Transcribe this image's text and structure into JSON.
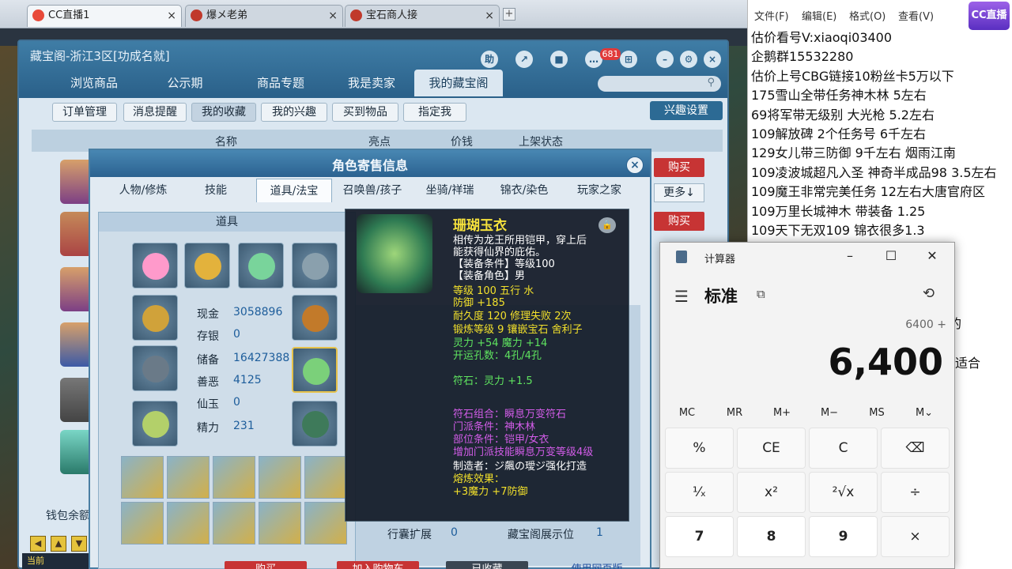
{
  "browser": {
    "tabs": [
      {
        "label": "CC直播1",
        "close": "×"
      },
      {
        "label": "爆メ老弟",
        "close": "×"
      },
      {
        "label": "宝石商人接",
        "close": "×"
      }
    ],
    "new_tab": "+"
  },
  "game_overlay": {
    "label": "当前"
  },
  "cbg": {
    "title": "藏宝阁-浙江3区[功成名就]",
    "help": "助",
    "message_count": "681",
    "nav_tabs": [
      "浏览商品",
      "公示期",
      "商品专题",
      "我是卖家",
      "我的藏宝阁"
    ],
    "sub_buttons": [
      "订单管理",
      "消息提醒",
      "我的收藏",
      "我的兴趣",
      "买到物品",
      "指定我"
    ],
    "interest_settings": "兴趣设置",
    "table_headers": [
      "名称",
      "亮点",
      "价钱",
      "上架状态"
    ],
    "buy": "购买",
    "more": "更多↓",
    "wallet": "钱包余额"
  },
  "dialog": {
    "title": "角色寄售信息",
    "close": "×",
    "tabs": [
      "人物/修炼",
      "技能",
      "道具/法宝",
      "召唤兽/孩子",
      "坐骑/祥瑞",
      "锦衣/染色",
      "玩家之家"
    ],
    "inventory_header": "道具",
    "stats": [
      {
        "label": "现金",
        "value": "3058896"
      },
      {
        "label": "存银",
        "value": "0"
      },
      {
        "label": "储备",
        "value": "16427388"
      },
      {
        "label": "善恶",
        "value": "4125"
      },
      {
        "label": "仙玉",
        "value": "0"
      },
      {
        "label": "精力",
        "value": "231"
      }
    ],
    "expand_label": "行囊扩展",
    "expand_value": "0",
    "showpos_label": "藏宝阁展示位",
    "showpos_value": "1",
    "bottom_buttons": [
      "购买",
      "加入购物车",
      "已收藏",
      "使用网页版"
    ]
  },
  "tooltip": {
    "name": "珊瑚玉衣",
    "lock": "🔒",
    "lines": [
      {
        "text": "相传为龙王所用铠甲，穿上后",
        "color": "w"
      },
      {
        "text": "能获得仙界的庇佑。",
        "color": "w"
      },
      {
        "text": "【装备条件】等级100",
        "color": "w"
      },
      {
        "text": "【装备角色】男",
        "color": "w"
      },
      {
        "text": "等级 100   五行 水",
        "color": "y"
      },
      {
        "text": "防御 +185",
        "color": "y"
      },
      {
        "text": "耐久度 120   修理失败 2次",
        "color": "y"
      },
      {
        "text": "锻炼等级 9   镶嵌宝石 舍利子",
        "color": "y"
      },
      {
        "text": "灵力 +54 魔力 +14",
        "color": "g"
      },
      {
        "text": "开运孔数：4孔/4孔",
        "color": "g"
      },
      {
        "text": "符石：灵力 +1.5",
        "color": "g"
      },
      {
        "text": "符石组合：瞬息万变符石",
        "color": "p"
      },
      {
        "text": "门派条件：神木林",
        "color": "p"
      },
      {
        "text": "部位条件：铠甲/女衣",
        "color": "p"
      },
      {
        "text": "增加门派技能瞬息万变等级4级",
        "color": "p"
      },
      {
        "text": "制造者：ジ飆の璦ジ强化打造",
        "color": "w"
      },
      {
        "text": "熔炼效果：",
        "color": "y"
      },
      {
        "text": "+3魔力 +7防御",
        "color": "y"
      }
    ]
  },
  "notepad": {
    "menu": [
      "文件(F)",
      "编辑(E)",
      "格式(O)",
      "查看(V)"
    ],
    "lines": [
      "估价看号V:xiaoqi03400",
      "企鹅群15532280",
      "估价上号CBG链接10粉丝卡5万以下",
      "175雪山全带任务神木林 5左右",
      "69将军带无级别 大光枪 5.2左右",
      "109解放碑 2个任务号 6千左右",
      "129女儿带三防御 9千左右 烟雨江南",
      "109凌波城超凡入圣 神奇半成品98 3.5左右",
      "109魔王非常完美任务 12左右大唐官府区",
      "109万里长城神木 带装备  1.25",
      "109天下无双109  锦衣很多1.3"
    ],
    "fragments": [
      "的",
      "适合"
    ],
    "logo": "CC直播"
  },
  "calculator": {
    "title": "计算器",
    "mode": "标准",
    "expression": "6400 +",
    "display": "6,400",
    "memory": [
      "MC",
      "MR",
      "M+",
      "M−",
      "MS",
      "M⌄"
    ],
    "keys": [
      "%",
      "CE",
      "C",
      "⌫",
      "¹⁄ₓ",
      "x²",
      "²√x",
      "÷",
      "7",
      "8",
      "9",
      "×"
    ]
  }
}
